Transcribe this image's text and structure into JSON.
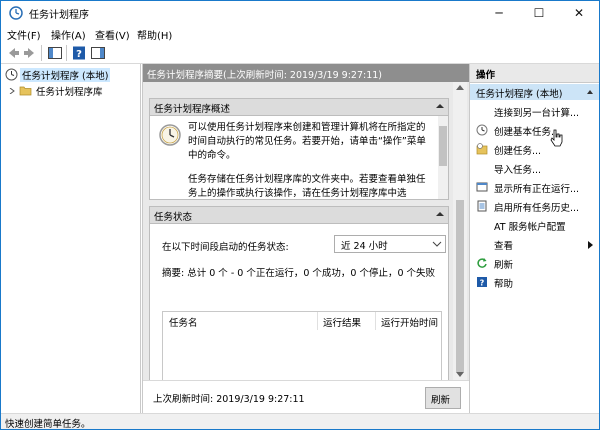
{
  "window": {
    "title": "任务计划程序",
    "controls": {
      "minimize": "─",
      "maximize": "☐",
      "close": "✕"
    }
  },
  "menu": [
    {
      "label": "文件(F)"
    },
    {
      "label": "操作(A)"
    },
    {
      "label": "查看(V)"
    },
    {
      "label": "帮助(H)"
    }
  ],
  "tree": [
    {
      "label": "任务计划程序 (本地)",
      "selected": true
    },
    {
      "label": "任务计划程序库",
      "selected": false
    }
  ],
  "center": {
    "header": "任务计划程序摘要(上次刷新时间: 2019/3/19 9:27:11)",
    "overview": {
      "title": "任务计划程序概述",
      "para1": "可以使用任务计划程序来创建和管理计算机将在所指定的时间自动执行的常见任务。若要开始，请单击“操作”菜单中的命令。",
      "para2": "任务存储在任务计划程序库的文件夹中。若要查看单独任务上的操作或执行该操作，请在任务计划程序库中选"
    },
    "status": {
      "title": "任务状态",
      "period_label": "在以下时间段启动的任务状态:",
      "period_value": "近 24 小时",
      "summary": "摘要: 总计 0 个 - 0 个正在运行，0 个成功，0 个停止，0 个失败",
      "columns": [
        "任务名",
        "运行结果",
        "运行开始时间"
      ]
    },
    "footer": {
      "last_refresh": "上次刷新时间: 2019/3/19 9:27:11",
      "refresh_button": "刷新"
    }
  },
  "actions": {
    "header": "操作",
    "group": "任务计划程序 (本地)",
    "items": [
      {
        "label": "连接到另一台计算...",
        "icon": "none"
      },
      {
        "label": "创建基本任务...",
        "icon": "task-wizard-icon"
      },
      {
        "label": "创建任务...",
        "icon": "create-task-icon"
      },
      {
        "label": "导入任务...",
        "icon": "none"
      },
      {
        "label": "显示所有正在运行...",
        "icon": "running-tasks-icon"
      },
      {
        "label": "启用所有任务历史...",
        "icon": "history-icon"
      },
      {
        "label": "AT 服务帐户配置",
        "icon": "none"
      },
      {
        "label": "查看",
        "icon": "none",
        "submenu": true
      },
      {
        "label": "刷新",
        "icon": "refresh-icon"
      },
      {
        "label": "帮助",
        "icon": "help-icon"
      }
    ]
  },
  "statusbar": {
    "text": "快速创建简单任务。"
  },
  "colors": {
    "accent": "#1979ca",
    "selection": "#cce4f7",
    "header_gray": "#8e8e8e"
  }
}
